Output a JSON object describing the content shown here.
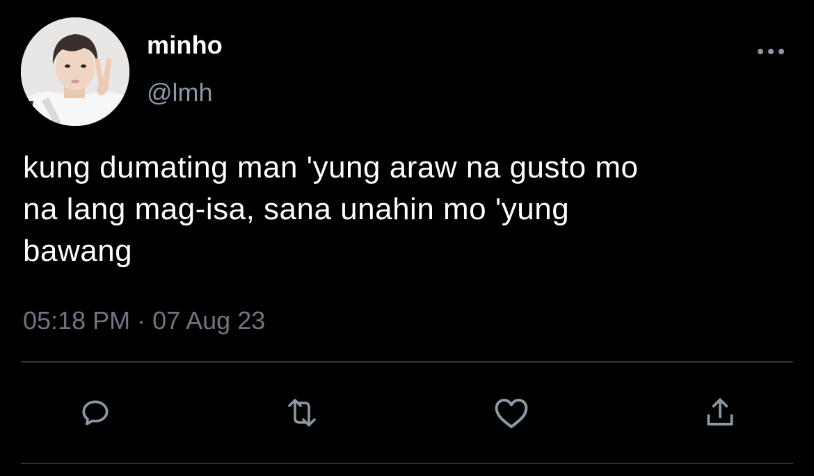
{
  "tweet": {
    "display_name": "minho",
    "handle": "@lmh",
    "text": "kung dumating man 'yung araw na gusto mo\nna lang mag-isa, sana unahin mo 'yung\nbawang",
    "timestamp": "05:18 PM · 07 Aug 23"
  },
  "icons": {
    "more": "more-horizontal-icon",
    "reply": "reply-icon",
    "retweet": "retweet-icon",
    "like": "heart-icon",
    "share": "share-icon"
  },
  "colors": {
    "background": "#000000",
    "text": "#ffffff",
    "secondary": "#8b98a5",
    "icon": "#8b98a5",
    "divider": "#2f3336"
  }
}
